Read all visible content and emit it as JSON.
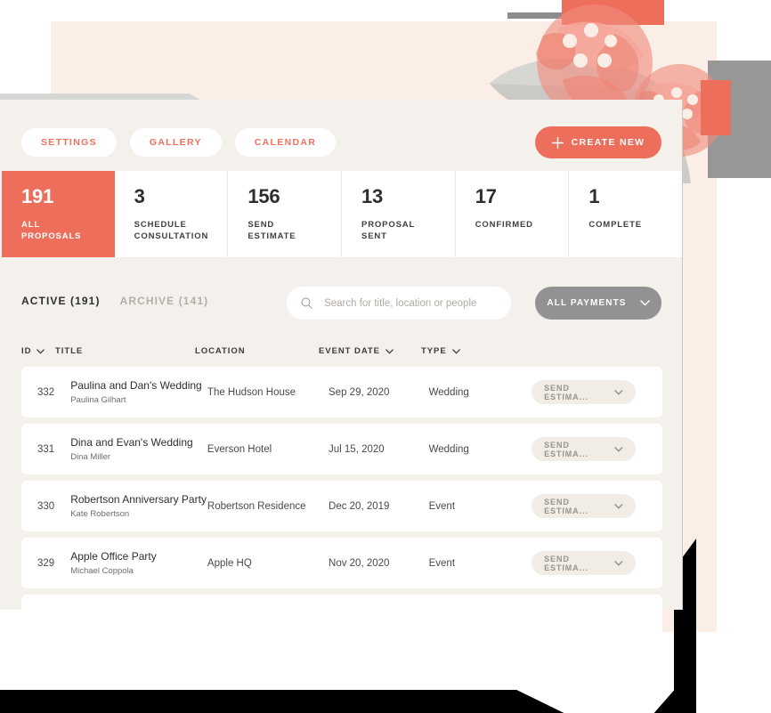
{
  "theme": {
    "accent": "#ee6e5c",
    "accent_text": "#f0705c",
    "panel_beige": "#faeee6",
    "app_bg": "#f4f1ec",
    "gray_block": "#979797",
    "payments_gray": "#929292",
    "action_btn_bg": "#f1ece5"
  },
  "nav_pills": [
    {
      "label": "SETTINGS",
      "name": "settings"
    },
    {
      "label": "GALLERY",
      "name": "gallery"
    },
    {
      "label": "CALENDAR",
      "name": "calendar"
    }
  ],
  "create_button": {
    "label": "CREATE NEW",
    "icon": "plus-icon"
  },
  "stats": [
    {
      "value": "191",
      "label": "ALL\nPROPOSALS",
      "line1": "ALL",
      "line2": "PROPOSALS",
      "active": true
    },
    {
      "value": "3",
      "label": "SCHEDULE CONSULTATION",
      "line1": "SCHEDULE",
      "line2": "CONSULTATION",
      "active": false
    },
    {
      "value": "156",
      "label": "SEND ESTIMATE",
      "line1": "SEND",
      "line2": "ESTIMATE",
      "active": false
    },
    {
      "value": "13",
      "label": "PROPOSAL SENT",
      "line1": "PROPOSAL",
      "line2": "SENT",
      "active": false
    },
    {
      "value": "17",
      "label": "CONFIRMED",
      "line1": "CONFIRMED",
      "line2": "",
      "active": false
    },
    {
      "value": "1",
      "label": "COMPLETE",
      "line1": "COMPLETE",
      "line2": "",
      "active": false
    }
  ],
  "list_tabs": [
    {
      "label": "ACTIVE (191)",
      "active": true
    },
    {
      "label": "ARCHIVE (141)",
      "active": false
    }
  ],
  "search": {
    "placeholder": "Search for title, location or people",
    "value": "",
    "icon": "search-icon"
  },
  "payments_filter": {
    "label": "ALL PAYMENTS",
    "icon": "chevron-down-icon"
  },
  "table": {
    "columns": [
      {
        "label": "ID",
        "sortable": true
      },
      {
        "label": "TITLE",
        "sortable": false
      },
      {
        "label": "LOCATION",
        "sortable": false
      },
      {
        "label": "EVENT DATE",
        "sortable": true
      },
      {
        "label": "TYPE",
        "sortable": true
      },
      {
        "label": "",
        "sortable": false
      }
    ],
    "rows": [
      {
        "id": "332",
        "title": "Paulina and Dan's Wedding",
        "person": "Paulina Gilhart",
        "location": "The Hudson House",
        "event_date": "Sep 29, 2020",
        "type": "Wedding",
        "action": "SEND ESTIMA..."
      },
      {
        "id": "331",
        "title": "Dina and Evan's Wedding",
        "person": "Dina Miller",
        "location": "Everson Hotel",
        "event_date": "Jul 15, 2020",
        "type": "Wedding",
        "action": "SEND ESTIMA..."
      },
      {
        "id": "330",
        "title": "Robertson Anniversary Party",
        "person": "Kate Robertson",
        "location": "Robertson Residence",
        "event_date": "Dec 20, 2019",
        "type": "Event",
        "action": "SEND ESTIMA..."
      },
      {
        "id": "329",
        "title": "Apple Office Party",
        "person": "Michael Coppola",
        "location": "Apple HQ",
        "event_date": "Nov 20, 2020",
        "type": "Event",
        "action": "SEND ESTIMA..."
      }
    ]
  }
}
